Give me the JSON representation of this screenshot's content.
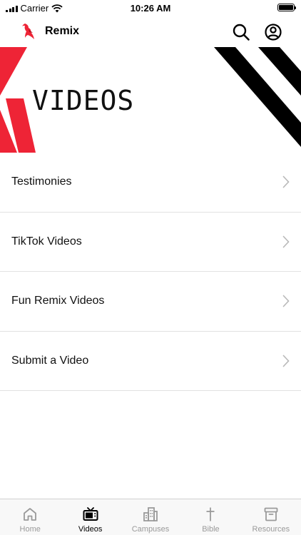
{
  "status_bar": {
    "carrier": "Carrier",
    "time": "10:26 AM"
  },
  "header": {
    "title": "Remix",
    "logo_icon": "remix-bird-logo",
    "search_icon": "search-icon",
    "account_icon": "account-circle-icon"
  },
  "hero": {
    "title": "VIDEOS",
    "accent_color": "#ee2436"
  },
  "list": {
    "items": [
      {
        "label": "Testimonies"
      },
      {
        "label": "TikTok Videos"
      },
      {
        "label": "Fun Remix Videos"
      },
      {
        "label": "Submit a Video"
      }
    ]
  },
  "tab_bar": {
    "tabs": [
      {
        "label": "Home",
        "icon": "home-icon",
        "active": false
      },
      {
        "label": "Videos",
        "icon": "tv-icon",
        "active": true
      },
      {
        "label": "Campuses",
        "icon": "buildings-icon",
        "active": false
      },
      {
        "label": "Bible",
        "icon": "cross-icon",
        "active": false
      },
      {
        "label": "Resources",
        "icon": "archive-box-icon",
        "active": false
      }
    ]
  }
}
